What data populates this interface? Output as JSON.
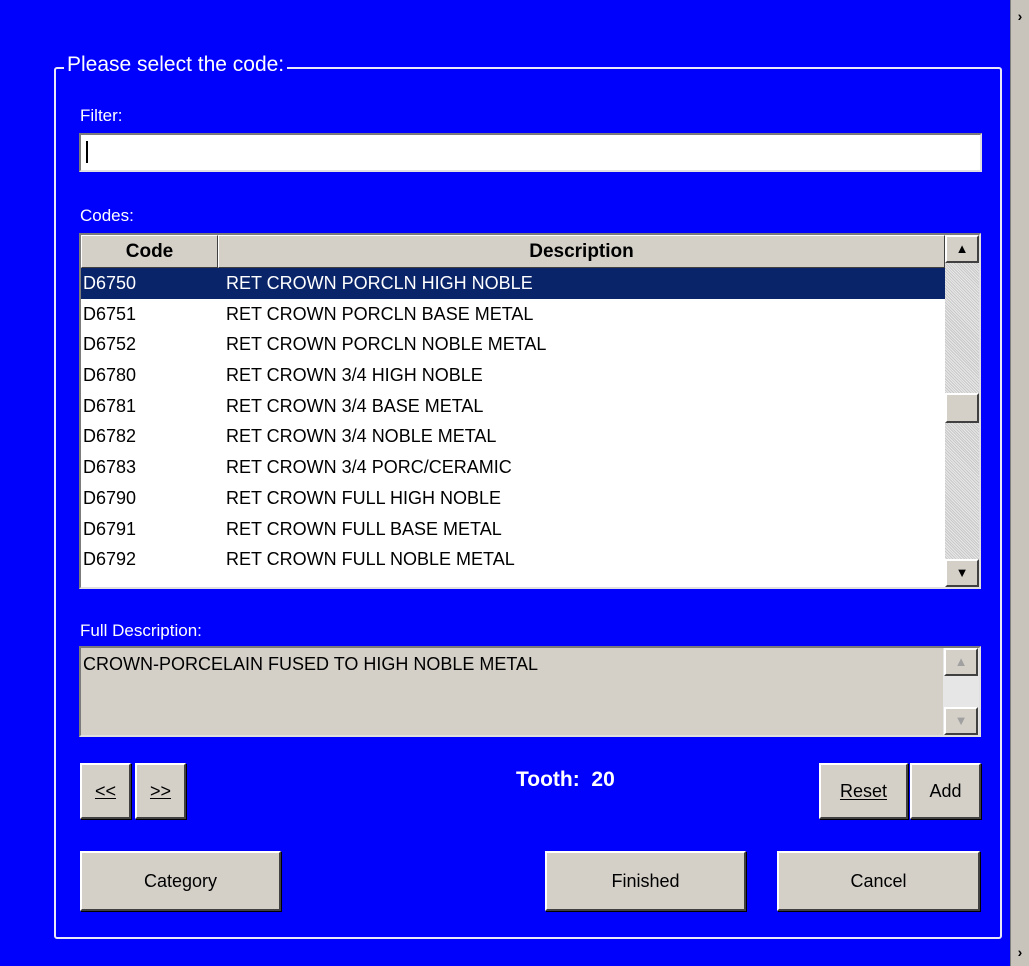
{
  "group": {
    "title": "Please select the code:"
  },
  "filter": {
    "label": "Filter:",
    "value": ""
  },
  "codes": {
    "label": "Codes:",
    "columns": [
      "Code",
      "Description"
    ],
    "selected_index": 0,
    "rows": [
      {
        "code": "D6750",
        "description": "RET CROWN PORCLN HIGH NOBLE"
      },
      {
        "code": "D6751",
        "description": "RET CROWN PORCLN BASE METAL"
      },
      {
        "code": "D6752",
        "description": "RET CROWN PORCLN NOBLE METAL"
      },
      {
        "code": "D6780",
        "description": "RET CROWN 3/4 HIGH NOBLE"
      },
      {
        "code": "D6781",
        "description": "RET CROWN 3/4 BASE METAL"
      },
      {
        "code": "D6782",
        "description": "RET CROWN 3/4 NOBLE METAL"
      },
      {
        "code": "D6783",
        "description": "RET CROWN 3/4 PORC/CERAMIC"
      },
      {
        "code": "D6790",
        "description": "RET CROWN FULL HIGH NOBLE"
      },
      {
        "code": "D6791",
        "description": "RET CROWN FULL BASE METAL"
      },
      {
        "code": "D6792",
        "description": "RET CROWN FULL NOBLE METAL"
      }
    ]
  },
  "full_description": {
    "label": "Full Description:",
    "text": "CROWN-PORCELAIN FUSED TO HIGH NOBLE METAL"
  },
  "nav": {
    "prev_label": "<<",
    "next_label": ">>"
  },
  "tooth": {
    "label": "Tooth:",
    "value": "20"
  },
  "buttons": {
    "reset": "Reset",
    "add": "Add",
    "category": "Category",
    "finished": "Finished",
    "cancel": "Cancel"
  },
  "colors": {
    "background": "#0000fd",
    "selection": "#0a246a",
    "button_face": "#d4d0c8"
  },
  "icons": {
    "side_top": "chevron-right-icon",
    "side_bottom": "chevron-right-icon",
    "scroll_up": "triangle-up-icon",
    "scroll_down": "triangle-down-icon"
  }
}
